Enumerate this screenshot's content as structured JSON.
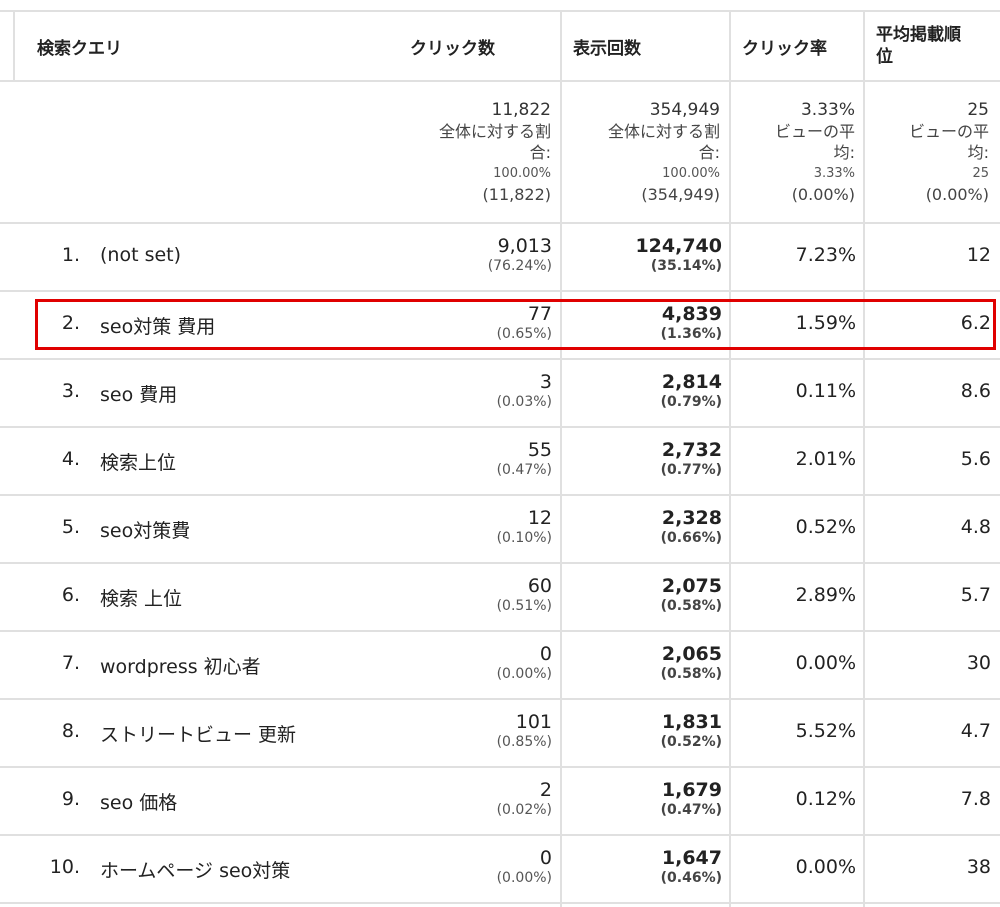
{
  "columns": {
    "query": "検索クエリ",
    "clicks": "クリック数",
    "impressions": "表示回数",
    "ctr": "クリック率",
    "position_line1": "平均掲載順",
    "position_line2": "位"
  },
  "totals": {
    "clicks": [
      "11,822",
      "全体に対する割",
      "合:",
      "100.00%",
      "(11,822)"
    ],
    "impressions": [
      "354,949",
      "全体に対する割",
      "合:",
      "100.00%",
      "(354,949)"
    ],
    "ctr": [
      "3.33%",
      "ビューの平",
      "均:",
      "3.33%",
      "(0.00%)"
    ],
    "position": [
      "25",
      "ビューの平",
      "均:",
      "25",
      "(0.00%)"
    ]
  },
  "rows": [
    {
      "rank": "1.",
      "query": "(not set)",
      "clicks": "9,013",
      "clicks_pct": "(76.24%)",
      "impressions": "124,740",
      "impressions_pct": "(35.14%)",
      "ctr": "7.23%",
      "position": "12"
    },
    {
      "rank": "2.",
      "query": "seo対策 費用",
      "clicks": "77",
      "clicks_pct": "(0.65%)",
      "impressions": "4,839",
      "impressions_pct": "(1.36%)",
      "ctr": "1.59%",
      "position": "6.2"
    },
    {
      "rank": "3.",
      "query": "seo 費用",
      "clicks": "3",
      "clicks_pct": "(0.03%)",
      "impressions": "2,814",
      "impressions_pct": "(0.79%)",
      "ctr": "0.11%",
      "position": "8.6"
    },
    {
      "rank": "4.",
      "query": "検索上位",
      "clicks": "55",
      "clicks_pct": "(0.47%)",
      "impressions": "2,732",
      "impressions_pct": "(0.77%)",
      "ctr": "2.01%",
      "position": "5.6"
    },
    {
      "rank": "5.",
      "query": "seo対策費",
      "clicks": "12",
      "clicks_pct": "(0.10%)",
      "impressions": "2,328",
      "impressions_pct": "(0.66%)",
      "ctr": "0.52%",
      "position": "4.8"
    },
    {
      "rank": "6.",
      "query": "検索 上位",
      "clicks": "60",
      "clicks_pct": "(0.51%)",
      "impressions": "2,075",
      "impressions_pct": "(0.58%)",
      "ctr": "2.89%",
      "position": "5.7"
    },
    {
      "rank": "7.",
      "query": "wordpress 初心者",
      "clicks": "0",
      "clicks_pct": "(0.00%)",
      "impressions": "2,065",
      "impressions_pct": "(0.58%)",
      "ctr": "0.00%",
      "position": "30"
    },
    {
      "rank": "8.",
      "query": "ストリートビュー 更新",
      "clicks": "101",
      "clicks_pct": "(0.85%)",
      "impressions": "1,831",
      "impressions_pct": "(0.52%)",
      "ctr": "5.52%",
      "position": "4.7"
    },
    {
      "rank": "9.",
      "query": "seo 価格",
      "clicks": "2",
      "clicks_pct": "(0.02%)",
      "impressions": "1,679",
      "impressions_pct": "(0.47%)",
      "ctr": "0.12%",
      "position": "7.8"
    },
    {
      "rank": "10.",
      "query": "ホームページ seo対策",
      "clicks": "0",
      "clicks_pct": "(0.00%)",
      "impressions": "1,647",
      "impressions_pct": "(0.46%)",
      "ctr": "0.00%",
      "position": "38"
    }
  ],
  "highlight": {
    "row_index": 1,
    "color": "#e00000"
  },
  "colors": {
    "grid": "#e0e0e0",
    "text": "#222222"
  }
}
